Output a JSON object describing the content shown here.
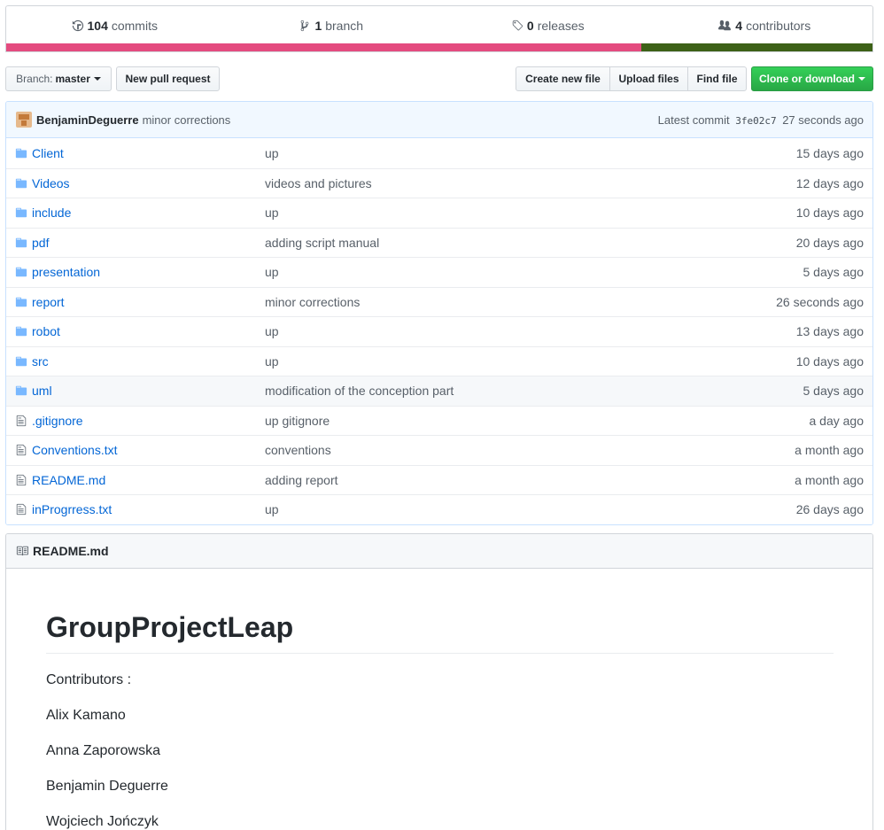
{
  "summary": {
    "commits_count": "104",
    "commits_label": "commits",
    "branch_count": "1",
    "branch_label": "branch",
    "releases_count": "0",
    "releases_label": "releases",
    "contributors_count": "4",
    "contributors_label": "contributors",
    "language_colors": [
      "#e44b7f",
      "#3d6117"
    ]
  },
  "toolbar": {
    "branch_prefix": "Branch:",
    "branch_name": "master",
    "new_pr_label": "New pull request",
    "create_file_label": "Create new file",
    "upload_label": "Upload files",
    "find_label": "Find file",
    "clone_label": "Clone or download"
  },
  "commit": {
    "author": "BenjaminDeguerre",
    "message": "minor corrections",
    "latest_label": "Latest commit",
    "sha": "3fe02c7",
    "age": "27 seconds ago"
  },
  "files": [
    {
      "type": "dir",
      "icon": "folder-icon",
      "name": "Client",
      "message": "up",
      "age": "15 days ago"
    },
    {
      "type": "dir",
      "icon": "folder-icon",
      "name": "Videos",
      "message": "videos and pictures",
      "age": "12 days ago"
    },
    {
      "type": "dir",
      "icon": "folder-icon",
      "name": "include",
      "message": "up",
      "age": "10 days ago"
    },
    {
      "type": "dir",
      "icon": "folder-icon",
      "name": "pdf",
      "message": "adding script manual",
      "age": "20 days ago"
    },
    {
      "type": "dir",
      "icon": "folder-icon",
      "name": "presentation",
      "message": "up",
      "age": "5 days ago"
    },
    {
      "type": "dir",
      "icon": "folder-icon",
      "name": "report",
      "message": "minor corrections",
      "age": "26 seconds ago"
    },
    {
      "type": "dir",
      "icon": "folder-icon",
      "name": "robot",
      "message": "up",
      "age": "13 days ago"
    },
    {
      "type": "dir",
      "icon": "folder-icon",
      "name": "src",
      "message": "up",
      "age": "10 days ago"
    },
    {
      "type": "dir",
      "icon": "folder-icon",
      "name": "uml",
      "message": "modification of the conception part",
      "age": "5 days ago"
    },
    {
      "type": "file",
      "icon": "file-icon",
      "name": ".gitignore",
      "message": "up gitignore",
      "age": "a day ago"
    },
    {
      "type": "file",
      "icon": "file-icon",
      "name": "Conventions.txt",
      "message": "conventions",
      "age": "a month ago"
    },
    {
      "type": "file",
      "icon": "file-icon",
      "name": "README.md",
      "message": "adding report",
      "age": "a month ago"
    },
    {
      "type": "file",
      "icon": "file-icon",
      "name": "inProgrress.txt",
      "message": "up",
      "age": "26 days ago"
    }
  ],
  "readme": {
    "filename": "README.md",
    "title": "GroupProjectLeap",
    "paragraphs": [
      "Contributors :",
      "Alix Kamano",
      "Anna Zaporowska",
      "Benjamin Deguerre",
      "Wojciech Jończyk"
    ]
  }
}
